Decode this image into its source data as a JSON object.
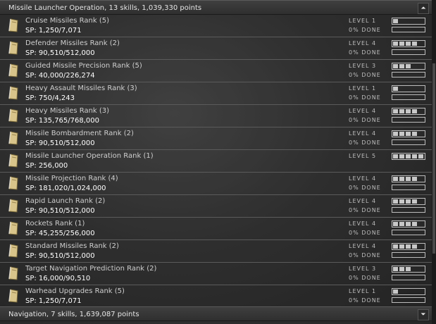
{
  "top_group": {
    "title": "Missile Launcher Operation, 13 skills, 1,039,330 points",
    "collapse_icon": "chevron-double-up-icon"
  },
  "bottom_group": {
    "title": "Navigation, 7 skills, 1,639,087 points",
    "expand_icon": "chevron-double-down-icon"
  },
  "skills": [
    {
      "name": "Cruise Missiles Rank (5)",
      "sp": "SP: 1,250/7,071",
      "level": "LEVEL 1",
      "done": "0% DONE",
      "trained": 1,
      "progress": 0
    },
    {
      "name": "Defender Missiles Rank (2)",
      "sp": "SP: 90,510/512,000",
      "level": "LEVEL 4",
      "done": "0% DONE",
      "trained": 4,
      "progress": 0
    },
    {
      "name": "Guided Missile Precision Rank (5)",
      "sp": "SP: 40,000/226,274",
      "level": "LEVEL 3",
      "done": "0% DONE",
      "trained": 3,
      "progress": 0
    },
    {
      "name": "Heavy Assault Missiles Rank (3)",
      "sp": "SP: 750/4,243",
      "level": "LEVEL 1",
      "done": "0% DONE",
      "trained": 1,
      "progress": 0
    },
    {
      "name": "Heavy Missiles Rank (3)",
      "sp": "SP: 135,765/768,000",
      "level": "LEVEL 4",
      "done": "0% DONE",
      "trained": 4,
      "progress": 0
    },
    {
      "name": "Missile Bombardment Rank (2)",
      "sp": "SP: 90,510/512,000",
      "level": "LEVEL 4",
      "done": "0% DONE",
      "trained": 4,
      "progress": 0
    },
    {
      "name": "Missile Launcher Operation Rank (1)",
      "sp": "SP: 256,000",
      "level": "LEVEL 5",
      "done": "",
      "trained": 5,
      "progress": 0
    },
    {
      "name": "Missile Projection Rank (4)",
      "sp": "SP: 181,020/1,024,000",
      "level": "LEVEL 4",
      "done": "0% DONE",
      "trained": 4,
      "progress": 0
    },
    {
      "name": "Rapid Launch Rank (2)",
      "sp": "SP: 90,510/512,000",
      "level": "LEVEL 4",
      "done": "0% DONE",
      "trained": 4,
      "progress": 0
    },
    {
      "name": "Rockets Rank (1)",
      "sp": "SP: 45,255/256,000",
      "level": "LEVEL 4",
      "done": "0% DONE",
      "trained": 4,
      "progress": 0
    },
    {
      "name": "Standard Missiles Rank (2)",
      "sp": "SP: 90,510/512,000",
      "level": "LEVEL 4",
      "done": "0% DONE",
      "trained": 4,
      "progress": 0
    },
    {
      "name": "Target Navigation Prediction Rank (2)",
      "sp": "SP: 16,000/90,510",
      "level": "LEVEL 3",
      "done": "0% DONE",
      "trained": 3,
      "progress": 0
    },
    {
      "name": "Warhead Upgrades Rank (5)",
      "sp": "SP: 1,250/7,071",
      "level": "LEVEL 1",
      "done": "0% DONE",
      "trained": 1,
      "progress": 0
    }
  ],
  "icons": {
    "skill": "skillbook-icon"
  },
  "colors": {
    "background": "#262626",
    "text": "#d2d2d2",
    "bar": "#c8c8c8",
    "book": "#d8c48a"
  }
}
